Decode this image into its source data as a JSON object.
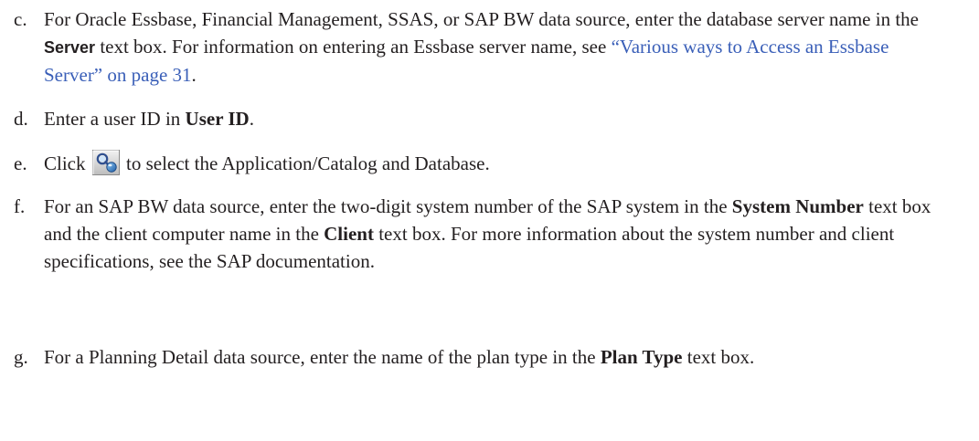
{
  "steps": [
    {
      "letter": "c.",
      "t1": "For Oracle Essbase, Financial Management, SSAS, or SAP BW data source, enter the database server name in the ",
      "b1": "Server",
      "t2": " text box. For information on entering an Essbase server name, see ",
      "link": "“Various ways to Access an Essbase Server” on page 31",
      "t3": "."
    },
    {
      "letter": "d.",
      "t1": "Enter a user ID in ",
      "b1": "User ID",
      "t2": "."
    },
    {
      "letter": "e.",
      "t1": "Click",
      "icon": "search-member-icon",
      "t2": " to select the Application/Catalog and Database."
    },
    {
      "letter": "f.",
      "t1": "For an SAP BW data source, enter the two-digit system number of the SAP system in the ",
      "b1": "System Number",
      "t2": " text box and the client computer name in the ",
      "b2": "Client",
      "t3": " text box. For more information about the system number and client specifications, see the SAP documentation."
    },
    {
      "letter": "g.",
      "t1": "For a Planning Detail data source, enter the name of the plan type in the ",
      "b1": "Plan Type",
      "t2": " text box."
    }
  ]
}
